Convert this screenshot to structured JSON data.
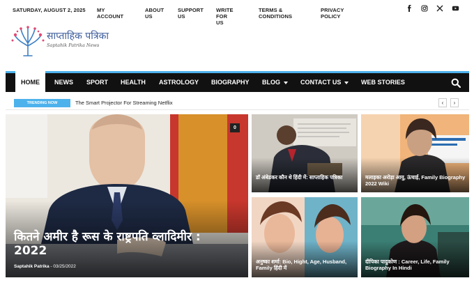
{
  "topbar": {
    "date": "SATURDAY, AUGUST 2, 2025",
    "links": [
      "MY ACCOUNT",
      "ABOUT US",
      "SUPPORT US",
      "WRITE FOR US",
      "TERMS & CONDITIONS",
      "PRIVACY POLICY"
    ],
    "social_icons": [
      "facebook-icon",
      "instagram-icon",
      "x-twitter-icon",
      "youtube-icon"
    ]
  },
  "logo": {
    "name": "साप्ताहिक पत्रिका",
    "tagline": "Saptahik Patrika News"
  },
  "nav": {
    "items": [
      "HOME",
      "NEWS",
      "SPORT",
      "HEALTH",
      "ASTROLOGY",
      "BIOGRAPHY",
      "BLOG",
      "CONTACT US",
      "WEB STORIES"
    ],
    "active": "HOME",
    "dropdown_items": [
      "BLOG",
      "CONTACT US"
    ],
    "accent": "#4db2ec"
  },
  "trending": {
    "badge": "TRENDING NOW",
    "headline": "The Smart Projector For Streaming Netflix",
    "prev": "‹",
    "next": "›"
  },
  "featured": {
    "title": "कितने अमीर है रूस के राष्ट्रपति व्लादिमीर : 2022",
    "author": "Saptahik Patrika",
    "date": "03/25/2022",
    "comments": "0"
  },
  "cards": [
    {
      "title": "डॉ अंबेडकर कौन थे हिंदी में: साप्ताहिक पत्रिका"
    },
    {
      "title": "मलाइका अरोड़ा आयु, ऊंचाई, Family Biography 2022 Wiki"
    },
    {
      "title": "अनुष्का शर्मा: Bio, Hight, Age, Husband, Family हिंदी में"
    },
    {
      "title": "दीपिका पादुकोण : Career, Life, Family Biography In Hindi"
    }
  ]
}
